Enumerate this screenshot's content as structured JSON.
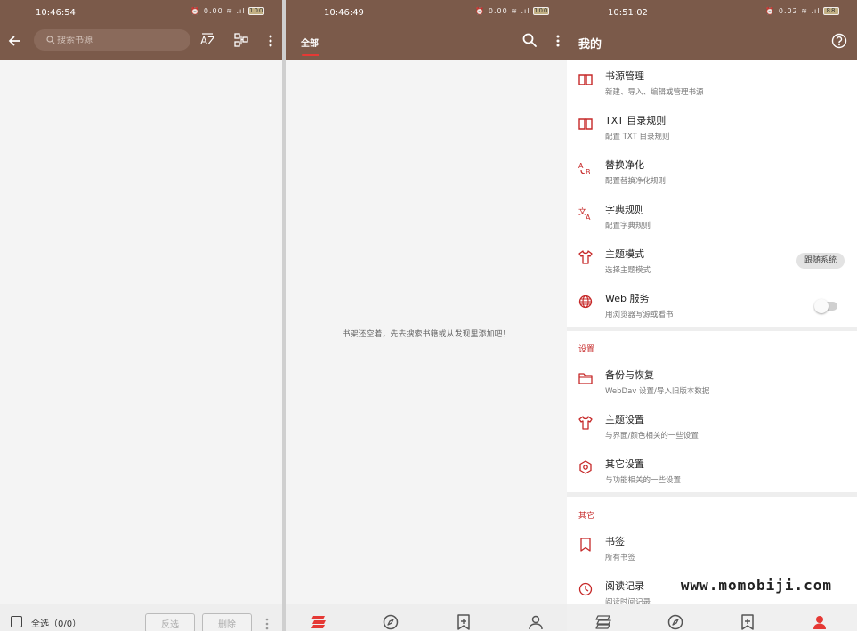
{
  "colors": {
    "appbar": "#7b5a4a",
    "accent": "#e53935",
    "text": "#222222"
  },
  "source_manager": {
    "time": "10:46:54",
    "status_icons": "⏰ 0.00 ≋ .ıl",
    "battery": "100",
    "search_placeholder": "搜索书源",
    "icons": [
      "back-arrow-icon",
      "sort-az-icon",
      "group-icon",
      "more-vert-icon"
    ],
    "select_all": "全选（0/0）",
    "invert_label": "反选",
    "delete_label": "删除"
  },
  "bookshelf": {
    "time": "10:46:49",
    "status_icons": "⏰ 0.00 ≋ .ıl",
    "battery": "100",
    "tab_all": "全部",
    "empty_message": "书架还空着，先去搜索书籍或从发现里添加吧！",
    "nav_items": [
      "bookshelf-icon",
      "explore-icon",
      "rss-bookmark-icon",
      "my-icon"
    ]
  },
  "my": {
    "time": "10:51:02",
    "status_icons": "⏰ 0.02 ≋ .ıl",
    "battery": "88",
    "title": "我的",
    "help_icon": "help-circle-icon",
    "items": [
      {
        "title": "书源管理",
        "subtitle": "新建、导入、编辑或管理书源",
        "icon": "book-open-icon"
      },
      {
        "title": "TXT 目录规则",
        "subtitle": "配置 TXT 目录规则",
        "icon": "book-open-icon"
      },
      {
        "title": "替换净化",
        "subtitle": "配置替换净化规则",
        "icon": "replace-icon"
      },
      {
        "title": "字典规则",
        "subtitle": "配置字典规则",
        "icon": "translate-icon"
      },
      {
        "title": "主题模式",
        "subtitle": "选择主题模式",
        "icon": "tshirt-icon",
        "value": "跟随系统"
      },
      {
        "title": "Web 服务",
        "subtitle": "用浏览器写源或看书",
        "icon": "globe-icon",
        "enabled": false
      }
    ],
    "settings_header": "设置",
    "settings_items": [
      {
        "title": "备份与恢复",
        "subtitle": "WebDav 设置/导入旧版本数据",
        "icon": "folder-icon"
      },
      {
        "title": "主题设置",
        "subtitle": "与界面/颜色相关的一些设置",
        "icon": "tshirt-icon"
      },
      {
        "title": "其它设置",
        "subtitle": "与功能相关的一些设置",
        "icon": "settings-gear-icon"
      }
    ],
    "other_header": "其它",
    "other_items": [
      {
        "title": "书签",
        "subtitle": "所有书签",
        "icon": "bookmark-icon"
      },
      {
        "title": "阅读记录",
        "subtitle": "阅读时间记录",
        "icon": "clock-icon"
      }
    ],
    "watermark": "www.momobiji.com"
  }
}
